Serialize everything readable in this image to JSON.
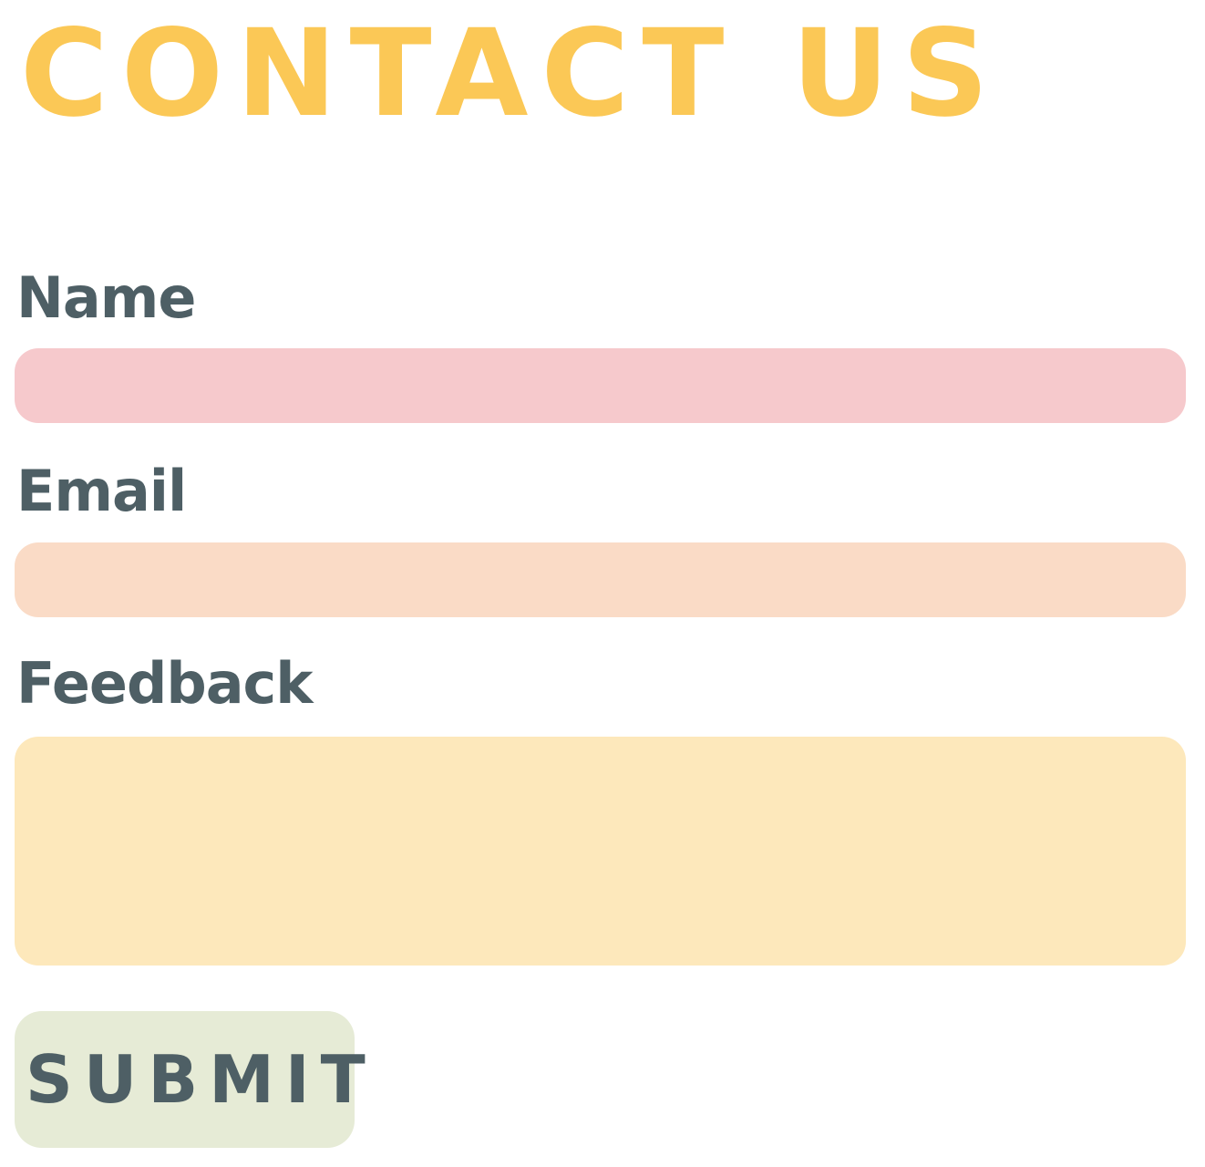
{
  "page": {
    "heading": "CONTACT US"
  },
  "form": {
    "name": {
      "label": "Name",
      "value": "",
      "placeholder": ""
    },
    "email": {
      "label": "Email",
      "value": "",
      "placeholder": ""
    },
    "feedback": {
      "label": "Feedback",
      "value": "",
      "placeholder": ""
    },
    "submit_label": "SUBMIT"
  },
  "colors": {
    "heading": "#fbc856",
    "label_text": "#4e5f65",
    "name_field_bg": "#f6c9cc",
    "email_field_bg": "#fadbc6",
    "feedback_field_bg": "#fde8bb",
    "submit_bg": "#e6ebd6"
  }
}
